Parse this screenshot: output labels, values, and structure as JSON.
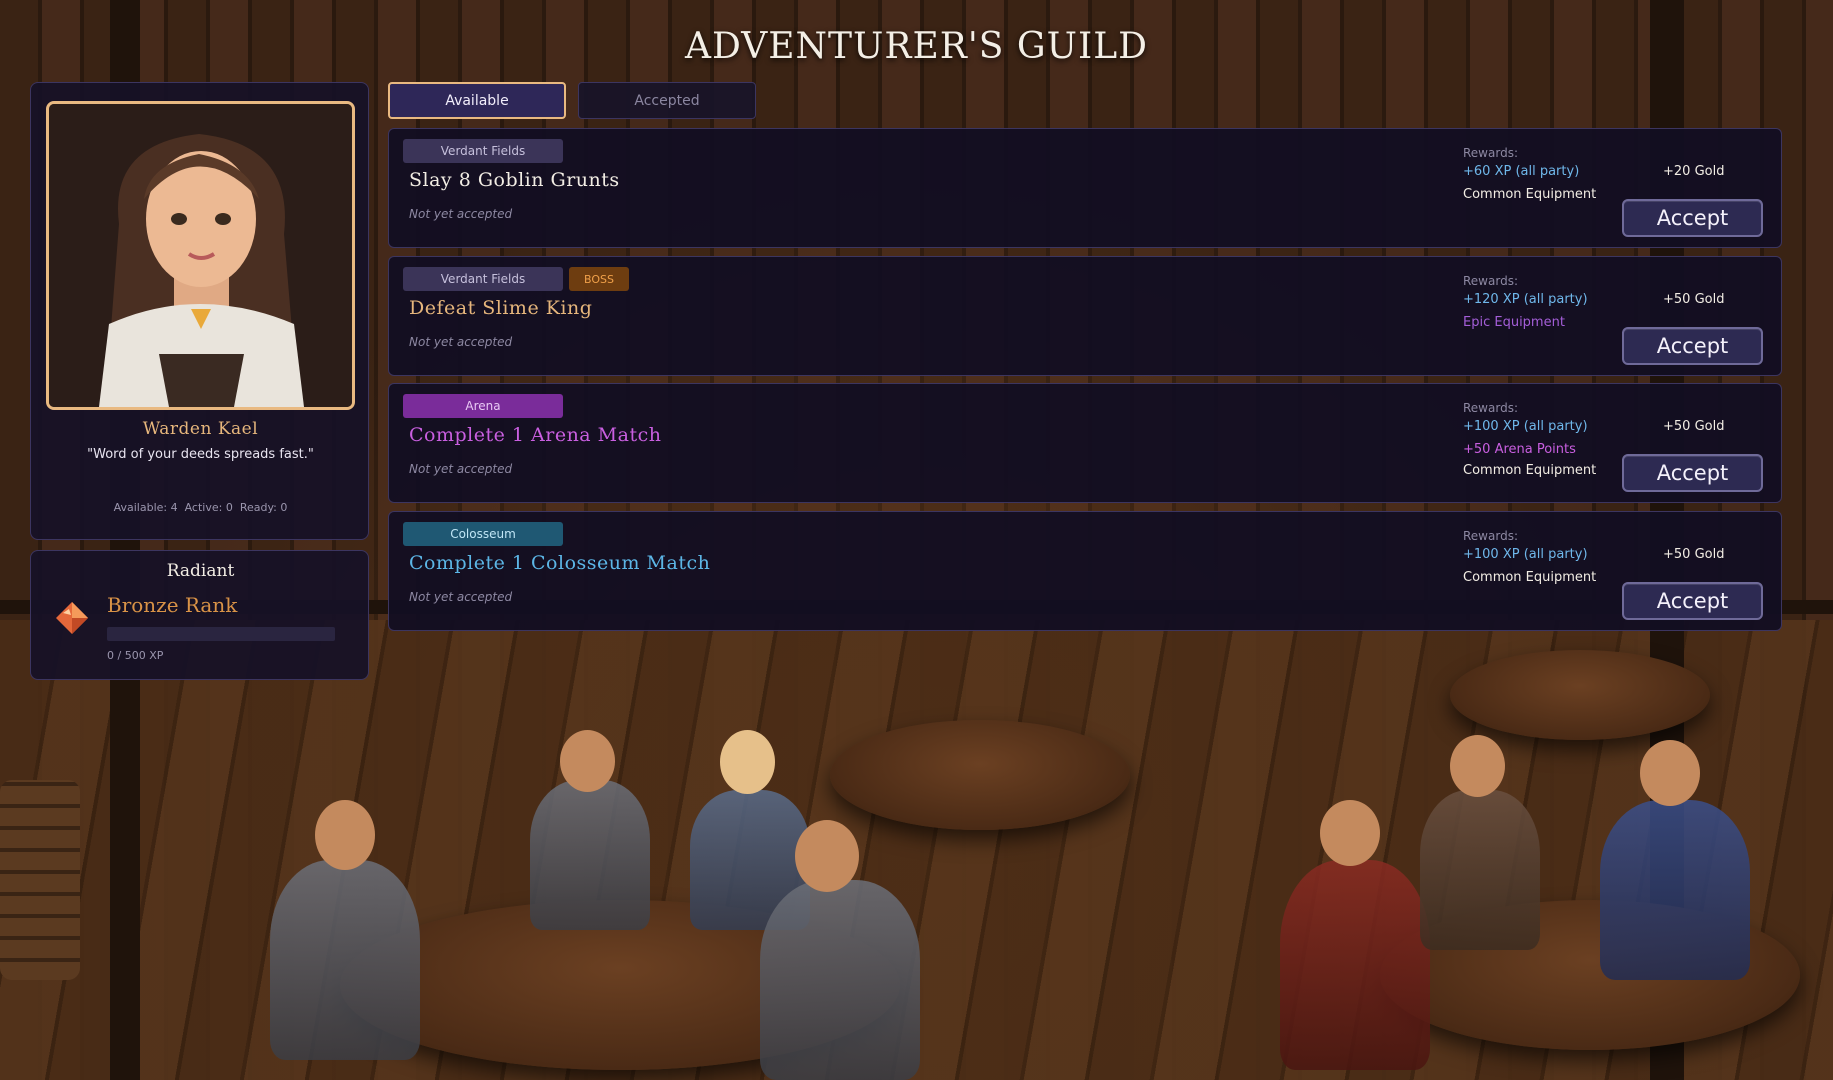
{
  "title": "ADVENTURER'S GUILD",
  "npc": {
    "name": "Warden Kael",
    "quote": "\"Word of your deeds spreads fast.\"",
    "stats": "Available: 4  Active: 0  Ready: 0"
  },
  "rank": {
    "title": "Radiant",
    "name": "Bronze Rank",
    "xp_text": "0 / 500 XP",
    "progress": 0
  },
  "tabs": [
    {
      "label": "Available",
      "active": true
    },
    {
      "label": "Accepted",
      "active": false
    }
  ],
  "quests": [
    {
      "tags": [
        "Verdant Fields"
      ],
      "title": "Slay 8 Goblin Grunts",
      "title_color": "#f2ede4",
      "status": "Not yet accepted",
      "rewards_label": "Rewards:",
      "xp": "+60 XP (all party)",
      "gold": "+20 Gold",
      "line2": "Common Equipment",
      "line2_color": "#f2ede4",
      "line3": "",
      "accept_label": "Accept"
    },
    {
      "tags": [
        "Verdant Fields",
        "BOSS"
      ],
      "title": "Defeat Slime King",
      "title_color": "#e6b67c",
      "status": "Not yet accepted",
      "rewards_label": "Rewards:",
      "xp": "+120 XP (all party)",
      "gold": "+50 Gold",
      "line2": "Epic Equipment",
      "line2_color": "#a45ed8",
      "line3": "",
      "accept_label": "Accept"
    },
    {
      "tags": [
        "Arena"
      ],
      "title": "Complete 1 Arena Match",
      "title_color": "#c95fe0",
      "status": "Not yet accepted",
      "rewards_label": "Rewards:",
      "xp": "+100 XP (all party)",
      "gold": "+50 Gold",
      "line2": "+50 Arena Points",
      "line2_color": "#c95fe0",
      "line3": "Common Equipment",
      "accept_label": "Accept"
    },
    {
      "tags": [
        "Colosseum"
      ],
      "title": "Complete 1 Colosseum Match",
      "title_color": "#5cb6e6",
      "status": "Not yet accepted",
      "rewards_label": "Rewards:",
      "xp": "+100 XP (all party)",
      "gold": "+50 Gold",
      "line2": "Common Equipment",
      "line2_color": "#f2ede4",
      "line3": "",
      "accept_label": "Accept"
    }
  ],
  "colors": {
    "panel": "#16112a",
    "border": "#3c3560",
    "accent_gold": "#e9b981",
    "xp_blue": "#6fb7ea",
    "rank_bronze": "#d99347"
  },
  "icons": {
    "rank": "orange-gem-icon"
  }
}
